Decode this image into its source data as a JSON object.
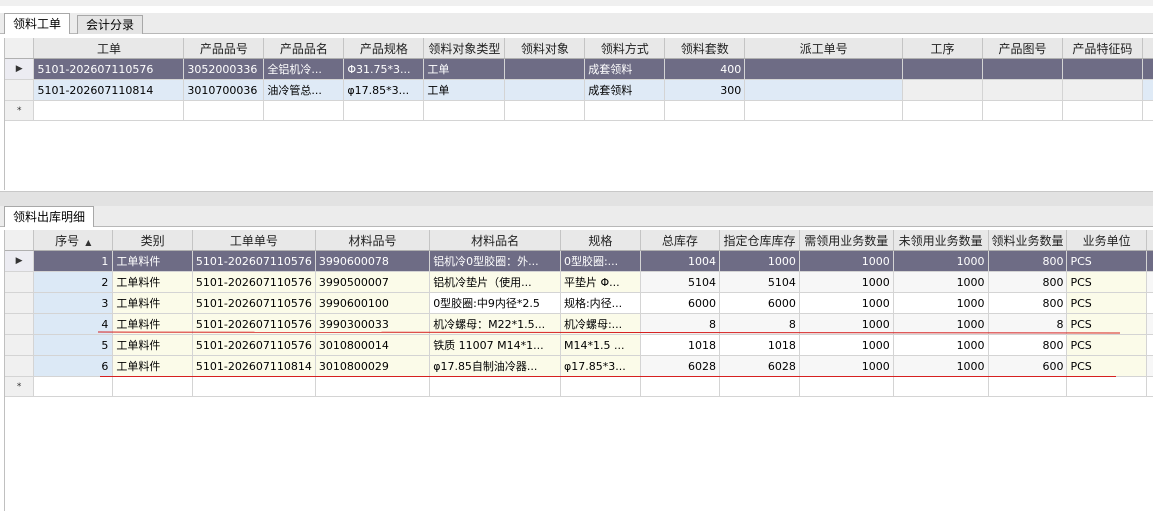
{
  "top_tabs": [
    {
      "label": "领料工单",
      "active": true
    },
    {
      "label": "会计分录",
      "active": false
    }
  ],
  "work_order_grid": {
    "columns": [
      "工单",
      "产品品号",
      "产品品名",
      "产品规格",
      "领料对象类型",
      "领料对象",
      "领料方式",
      "领料套数",
      "派工单号",
      "工序",
      "产品图号",
      "产品特征码"
    ],
    "rows": [
      {
        "indicator": "▶",
        "work_order": "5101-202607110576",
        "product_no": "3052000336",
        "product_name": "全铝机冷...",
        "product_spec": "Φ31.75*3...",
        "object_type": "工单",
        "object": "",
        "method": "成套领料",
        "sets": "400",
        "dispatch_no": "",
        "process": "",
        "drawing_no": "",
        "feature_code": ""
      },
      {
        "indicator": "",
        "work_order": "5101-202607110814",
        "product_no": "3010700036",
        "product_name": "油冷管总...",
        "product_spec": "φ17.85*3...",
        "object_type": "工单",
        "object": "",
        "method": "成套领料",
        "sets": "300",
        "dispatch_no": "",
        "process": "",
        "drawing_no": "",
        "feature_code": ""
      }
    ],
    "new_row_indicator": "*"
  },
  "bottom_tabs": [
    {
      "label": "领料出库明细",
      "active": true
    }
  ],
  "detail_grid": {
    "columns": [
      "序号",
      "类别",
      "工单单号",
      "材料品号",
      "材料品名",
      "规格",
      "总库存",
      "指定仓库库存",
      "需领用业务数量",
      "未领用业务数量",
      "领料业务数量",
      "业务单位"
    ],
    "sort_icon": "▲",
    "rows": [
      {
        "indicator": "▶",
        "seq": "1",
        "category": "工单料件",
        "work_order": "5101-202607110576",
        "material_no": "3990600078",
        "material_name": "铝机冷0型胶圈：外...",
        "spec": "0型胶圈:...",
        "total_stock": "1004",
        "warehouse_stock": "1000",
        "required_qty": "1000",
        "unissued_qty": "1000",
        "issue_qty": "800",
        "unit": "PCS"
      },
      {
        "indicator": "",
        "seq": "2",
        "category": "工单料件",
        "work_order": "5101-202607110576",
        "material_no": "3990500007",
        "material_name": "铝机冷垫片（使用...",
        "spec": "平垫片 Φ...",
        "total_stock": "5104",
        "warehouse_stock": "5104",
        "required_qty": "1000",
        "unissued_qty": "1000",
        "issue_qty": "800",
        "unit": "PCS"
      },
      {
        "indicator": "",
        "seq": "3",
        "category": "工单料件",
        "work_order": "5101-202607110576",
        "material_no": "3990600100",
        "material_name": "0型胶圈:中9内径*2.5",
        "spec": "规格:内径...",
        "total_stock": "6000",
        "warehouse_stock": "6000",
        "required_qty": "1000",
        "unissued_qty": "1000",
        "issue_qty": "800",
        "unit": "PCS"
      },
      {
        "indicator": "",
        "seq": "4",
        "category": "工单料件",
        "work_order": "5101-202607110576",
        "material_no": "3990300033",
        "material_name": "机冷螺母：M22*1.5...",
        "spec": "机冷螺母:...",
        "total_stock": "8",
        "warehouse_stock": "8",
        "required_qty": "1000",
        "unissued_qty": "1000",
        "issue_qty": "8",
        "unit": "PCS"
      },
      {
        "indicator": "",
        "seq": "5",
        "category": "工单料件",
        "work_order": "5101-202607110576",
        "material_no": "3010800014",
        "material_name": "铁质 11007 M14*1...",
        "spec": "M14*1.5 ...",
        "total_stock": "1018",
        "warehouse_stock": "1018",
        "required_qty": "1000",
        "unissued_qty": "1000",
        "issue_qty": "800",
        "unit": "PCS"
      },
      {
        "indicator": "",
        "seq": "6",
        "category": "工单料件",
        "work_order": "5101-202607110814",
        "material_no": "3010800029",
        "material_name": "φ17.85自制油冷器...",
        "spec": "φ17.85*3...",
        "total_stock": "6028",
        "warehouse_stock": "6028",
        "required_qty": "1000",
        "unissued_qty": "1000",
        "issue_qty": "600",
        "unit": "PCS"
      }
    ],
    "new_row_indicator": "*"
  },
  "colors": {
    "selected_row": "#6e6c85",
    "alt_row": "#dfeaf6",
    "seq_column": "#dce9f6",
    "category_column": "#fbfbe9",
    "annotation_line": "#d62020"
  }
}
